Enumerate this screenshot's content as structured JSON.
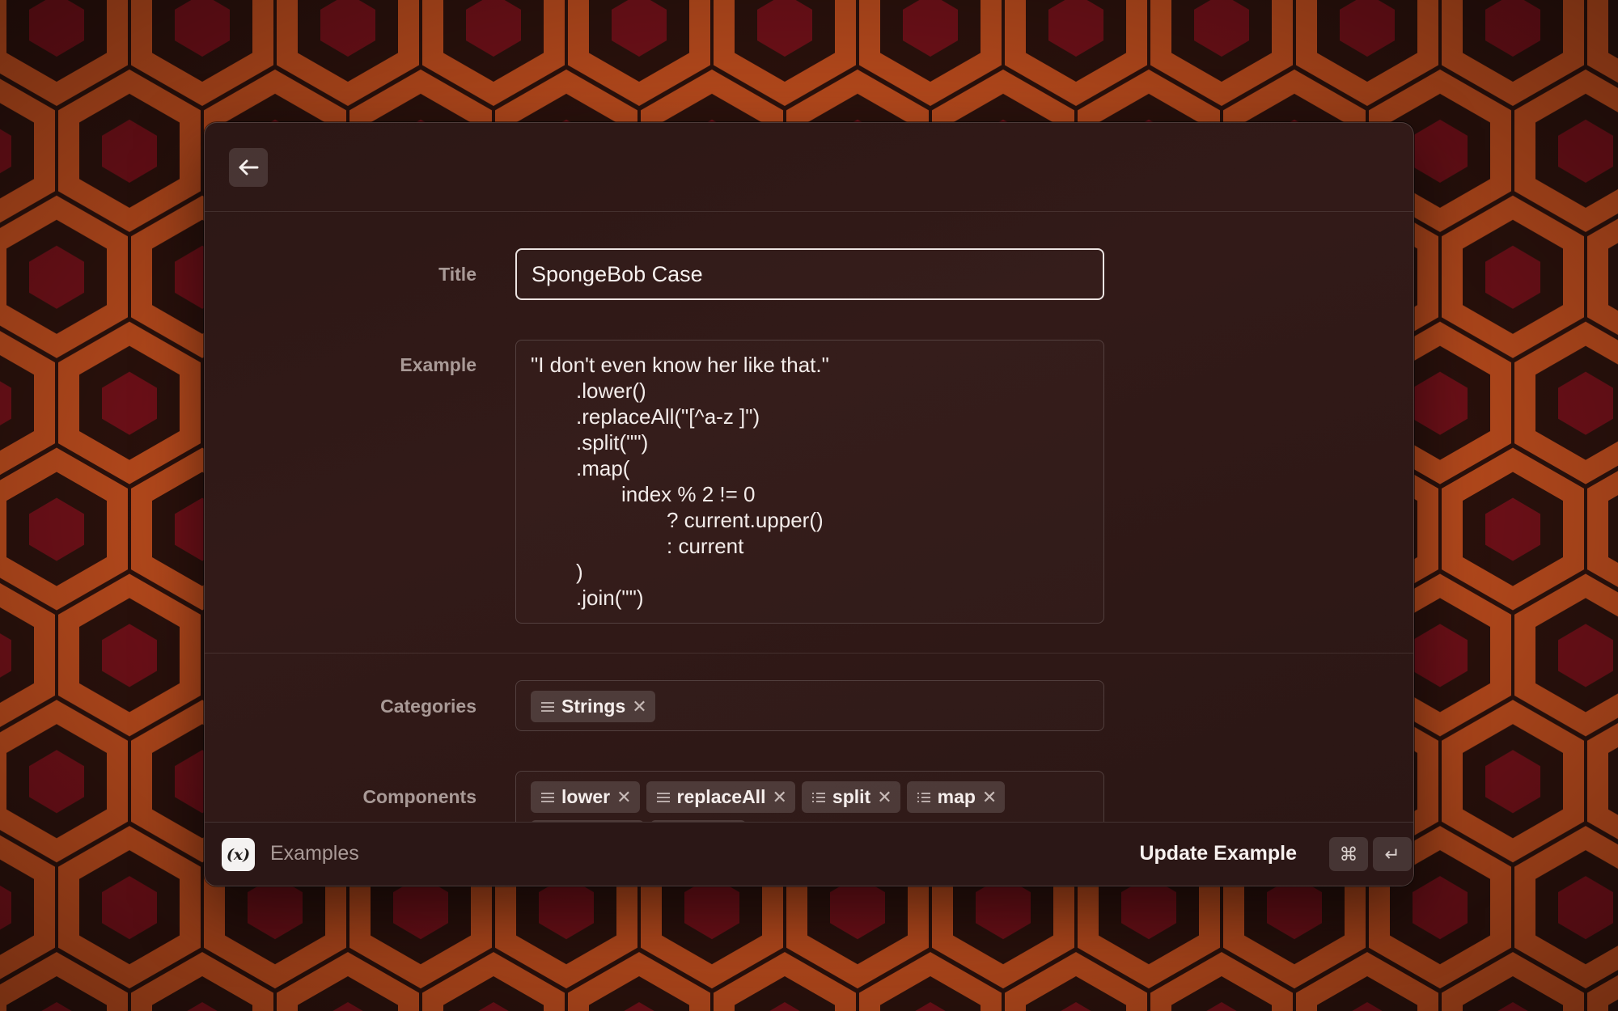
{
  "header": {
    "back_icon": "arrow-left-icon"
  },
  "form": {
    "title_label": "Title",
    "title_value": "SpongeBob Case",
    "example_label": "Example",
    "example_lines": [
      "\"I don't even know her like that.\"",
      "\t.lower()",
      "\t.replaceAll(\"[^a-z ]\")",
      "\t.split(\"\")",
      "\t.map(",
      "\t\tindex % 2 != 0",
      "\t\t\t? current.upper()",
      "\t\t\t: current",
      "\t)",
      "\t.join(\"\")"
    ],
    "categories_label": "Categories",
    "categories": [
      {
        "label": "Strings",
        "icon": "list-icon"
      }
    ],
    "components_label": "Components",
    "components": [
      {
        "label": "lower",
        "icon": "list-icon"
      },
      {
        "label": "replaceAll",
        "icon": "list-icon"
      },
      {
        "label": "split",
        "icon": "list-bullet-icon"
      },
      {
        "label": "map",
        "icon": "list-bullet-icon"
      }
    ]
  },
  "footer": {
    "app_icon_glyph": "(x)",
    "app_name": "Examples",
    "primary_action": "Update Example",
    "shortcut_cmd": "⌘",
    "shortcut_enter": "↵"
  },
  "colors": {
    "window_bg": "#2c1715",
    "label": "#a99a97",
    "text": "#f1e9e7",
    "wallpaper_orange": "#b84a1c",
    "wallpaper_red": "#7a121a",
    "wallpaper_dark": "#2a110c"
  }
}
